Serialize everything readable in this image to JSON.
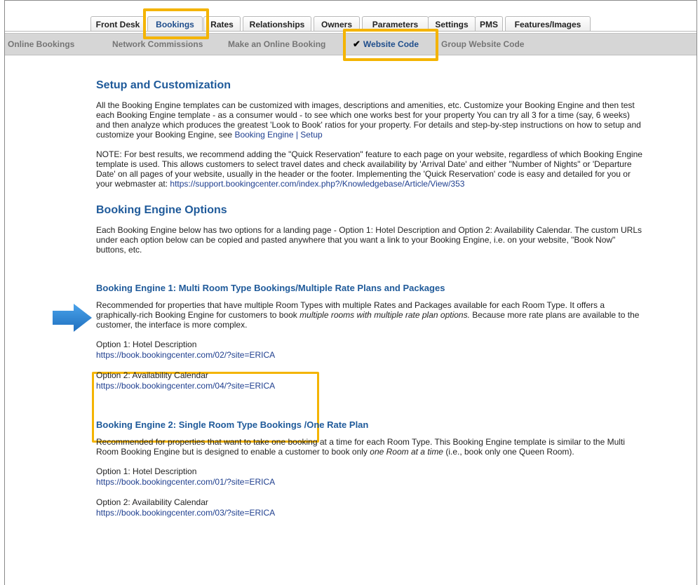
{
  "tabs": [
    "Front Desk",
    "Bookings",
    "Rates",
    "Relationships",
    "Owners",
    "Parameters",
    "Settings",
    "PMS",
    "Features/Images"
  ],
  "subnav": [
    "Online Bookings",
    "Network Commissions",
    "Make an Online Booking",
    "Website Code",
    "Group Website Code"
  ],
  "subnav_check": "✔",
  "setup": {
    "title": "Setup and Customization",
    "p1": "All the Booking Engine templates can be customized with images, descriptions and amenities, etc. Customize your Booking Engine and then test each Booking Engine template - as a consumer would - to see which one works best for your property You can try all 3 for a time (say, 6 weeks) and then analyze which produces the greatest 'Look to Book' ratios for your property. For details and step-by-step instructions on how to setup and customize your Booking Engine, see",
    "p1_link": "Booking Engine | Setup",
    "p2": "NOTE: For best results, we recommend adding the \"Quick Reservation\" feature to each page on your website, regardless of which Booking Engine template is used. This allows customers to select travel dates and check availability by 'Arrival Date' and either \"Number of Nights\" or 'Departure Date' on all pages of your website, usually in the header or the footer. Implementing the 'Quick Reservation' code is easy and detailed for you or your webmaster at:",
    "p2_link": "https://support.bookingcenter.com/index.php?/Knowledgebase/Article/View/353"
  },
  "options": {
    "title": "Booking Engine Options",
    "p": "Each Booking Engine below has two options for a landing page - Option 1: Hotel Description and Option 2: Availability Calendar. The custom URLs under each option below can be copied and pasted anywhere that you want a link to your Booking Engine, i.e. on your website, \"Book Now\" buttons, etc."
  },
  "engine1": {
    "title": "Booking Engine 1: Multi Room Type Bookings/Multiple Rate Plans and Packages",
    "desc_a": "Recommended for properties that have multiple Room Types with multiple Rates and Packages available for each Room Type. It offers a graphically-rich Booking Engine for customers to book",
    "desc_em": "multiple rooms with multiple rate plan options.",
    "desc_b": "Because more rate plans are available to the customer, the interface is more complex.",
    "opt1_label": "Option 1: Hotel Description",
    "opt1_url": "https://book.bookingcenter.com/02/?site=ERICA",
    "opt2_label": "Option 2: Availability Calendar",
    "opt2_url": "https://book.bookingcenter.com/04/?site=ERICA"
  },
  "engine2": {
    "title": "Booking Engine 2: Single Room Type Bookings /One Rate Plan",
    "desc_a": "Recommended for properties that want to take one booking at a time for each Room Type. This Booking Engine template is similar to the Multi Room Booking Engine but is designed to enable a customer to book only",
    "desc_em": "one Room at a time",
    "desc_b": "(i.e., book only one Queen Room).",
    "opt1_label": "Option 1: Hotel Description",
    "opt1_url": "https://book.bookingcenter.com/01/?site=ERICA",
    "opt2_label": "Option 2: Availability Calendar",
    "opt2_url": "https://book.bookingcenter.com/03/?site=ERICA"
  },
  "colors": {
    "highlight": "#f4b400",
    "heading": "#1f5a9a",
    "link": "#1f3f8f",
    "arrow": "#2a7fd0",
    "subnav_bg": "#d6d6d6"
  }
}
